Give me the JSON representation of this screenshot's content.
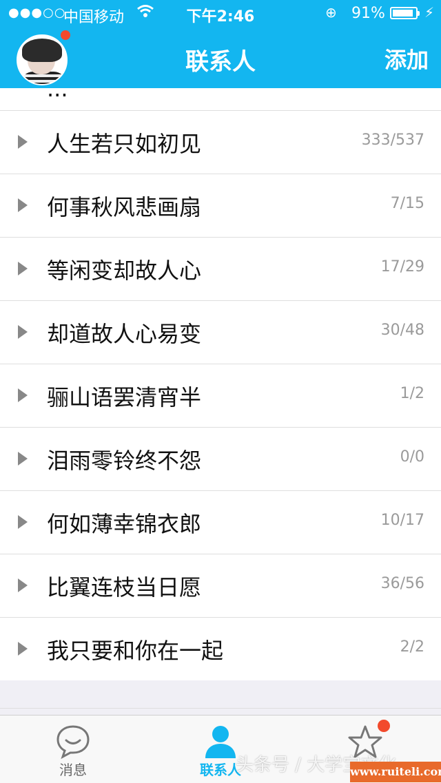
{
  "status_bar": {
    "signal": "●●●○○",
    "carrier": "中国移动",
    "time": "下午2:46",
    "battery_percent": "91%",
    "battery_level": 0.91
  },
  "nav": {
    "title": "联系人",
    "add_label": "添加"
  },
  "colors": {
    "header": "#13b6f0",
    "badge": "#f24a2c"
  },
  "partial_row_label": "...",
  "groups": [
    {
      "name": "人生若只如初见",
      "count": "333/537"
    },
    {
      "name": "何事秋风悲画扇",
      "count": "7/15"
    },
    {
      "name": "等闲变却故人心",
      "count": "17/29"
    },
    {
      "name": "却道故人心易变",
      "count": "30/48"
    },
    {
      "name": "骊山语罢清宵半",
      "count": "1/2"
    },
    {
      "name": "泪雨零铃终不怨",
      "count": "0/0"
    },
    {
      "name": "何如薄幸锦衣郎",
      "count": "10/17"
    },
    {
      "name": "比翼连枝当日愿",
      "count": "36/56"
    },
    {
      "name": "我只要和你在一起",
      "count": "2/2"
    }
  ],
  "tabs": [
    {
      "label": "消息",
      "icon": "chat-bubble-icon"
    },
    {
      "label": "联系人",
      "icon": "person-icon"
    },
    {
      "label": "",
      "icon": "star-icon"
    }
  ],
  "watermarks": {
    "toutiao": "头条号 / 大学宝文化",
    "url": "www.ruiteli.com"
  }
}
